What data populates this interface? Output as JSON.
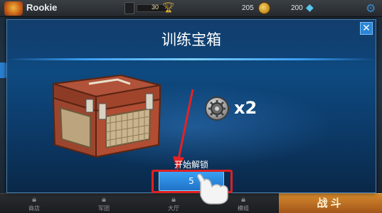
{
  "topbar": {
    "player_name": "Rookie",
    "xp_value": "30",
    "coins": "205",
    "gems": "200"
  },
  "bottom_nav": {
    "items": [
      {
        "label": "商店"
      },
      {
        "label": "军团"
      },
      {
        "label": "大厅"
      },
      {
        "label": "模组"
      }
    ],
    "battle_label": "战斗"
  },
  "modal": {
    "title": "训练宝箱",
    "close_label": "✕",
    "reward_count": "x2",
    "unlock_label": "开始解锁",
    "unlock_button_label": "5"
  },
  "colors": {
    "modal_bg": "#0e4a80",
    "accent_blue": "#2a86d8",
    "highlight_red": "#e02020",
    "battle_orange": "#d58a2c"
  }
}
